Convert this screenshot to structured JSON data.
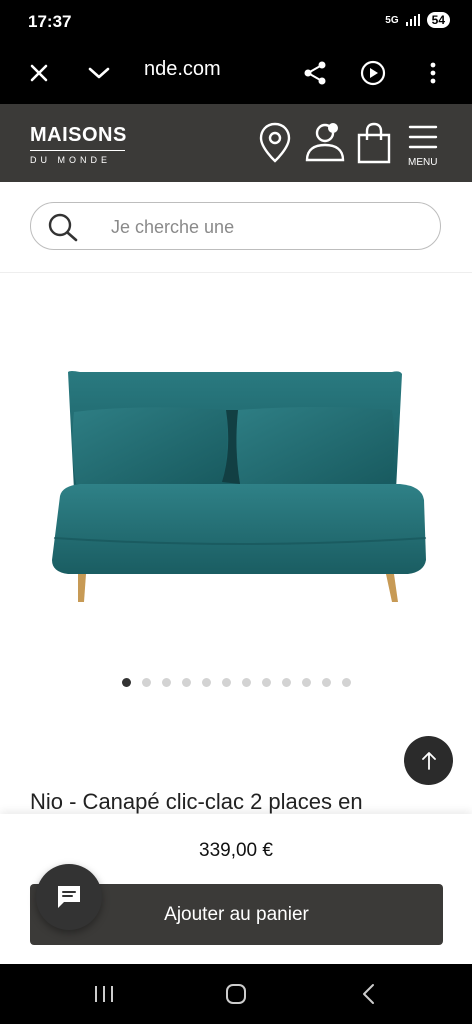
{
  "status_bar": {
    "time": "17:37",
    "network": "5G",
    "battery": "54"
  },
  "browser": {
    "url": "nde.com"
  },
  "header": {
    "logo_main": "MAISONS",
    "logo_sub": "DU MONDE",
    "menu_label": "MENU"
  },
  "search": {
    "placeholder": "Je cherche une"
  },
  "product": {
    "title": "Nio - Canapé clic-clac 2 places en",
    "price": "339,00 €",
    "add_to_cart_label": "Ajouter au panier",
    "sofa_color": "#1f6b70"
  },
  "carousel": {
    "total": 12,
    "active": 1
  },
  "colors": {
    "header_bg": "#3b3a38",
    "button_bg": "#3b3a38",
    "accent": "#1f6b70"
  }
}
